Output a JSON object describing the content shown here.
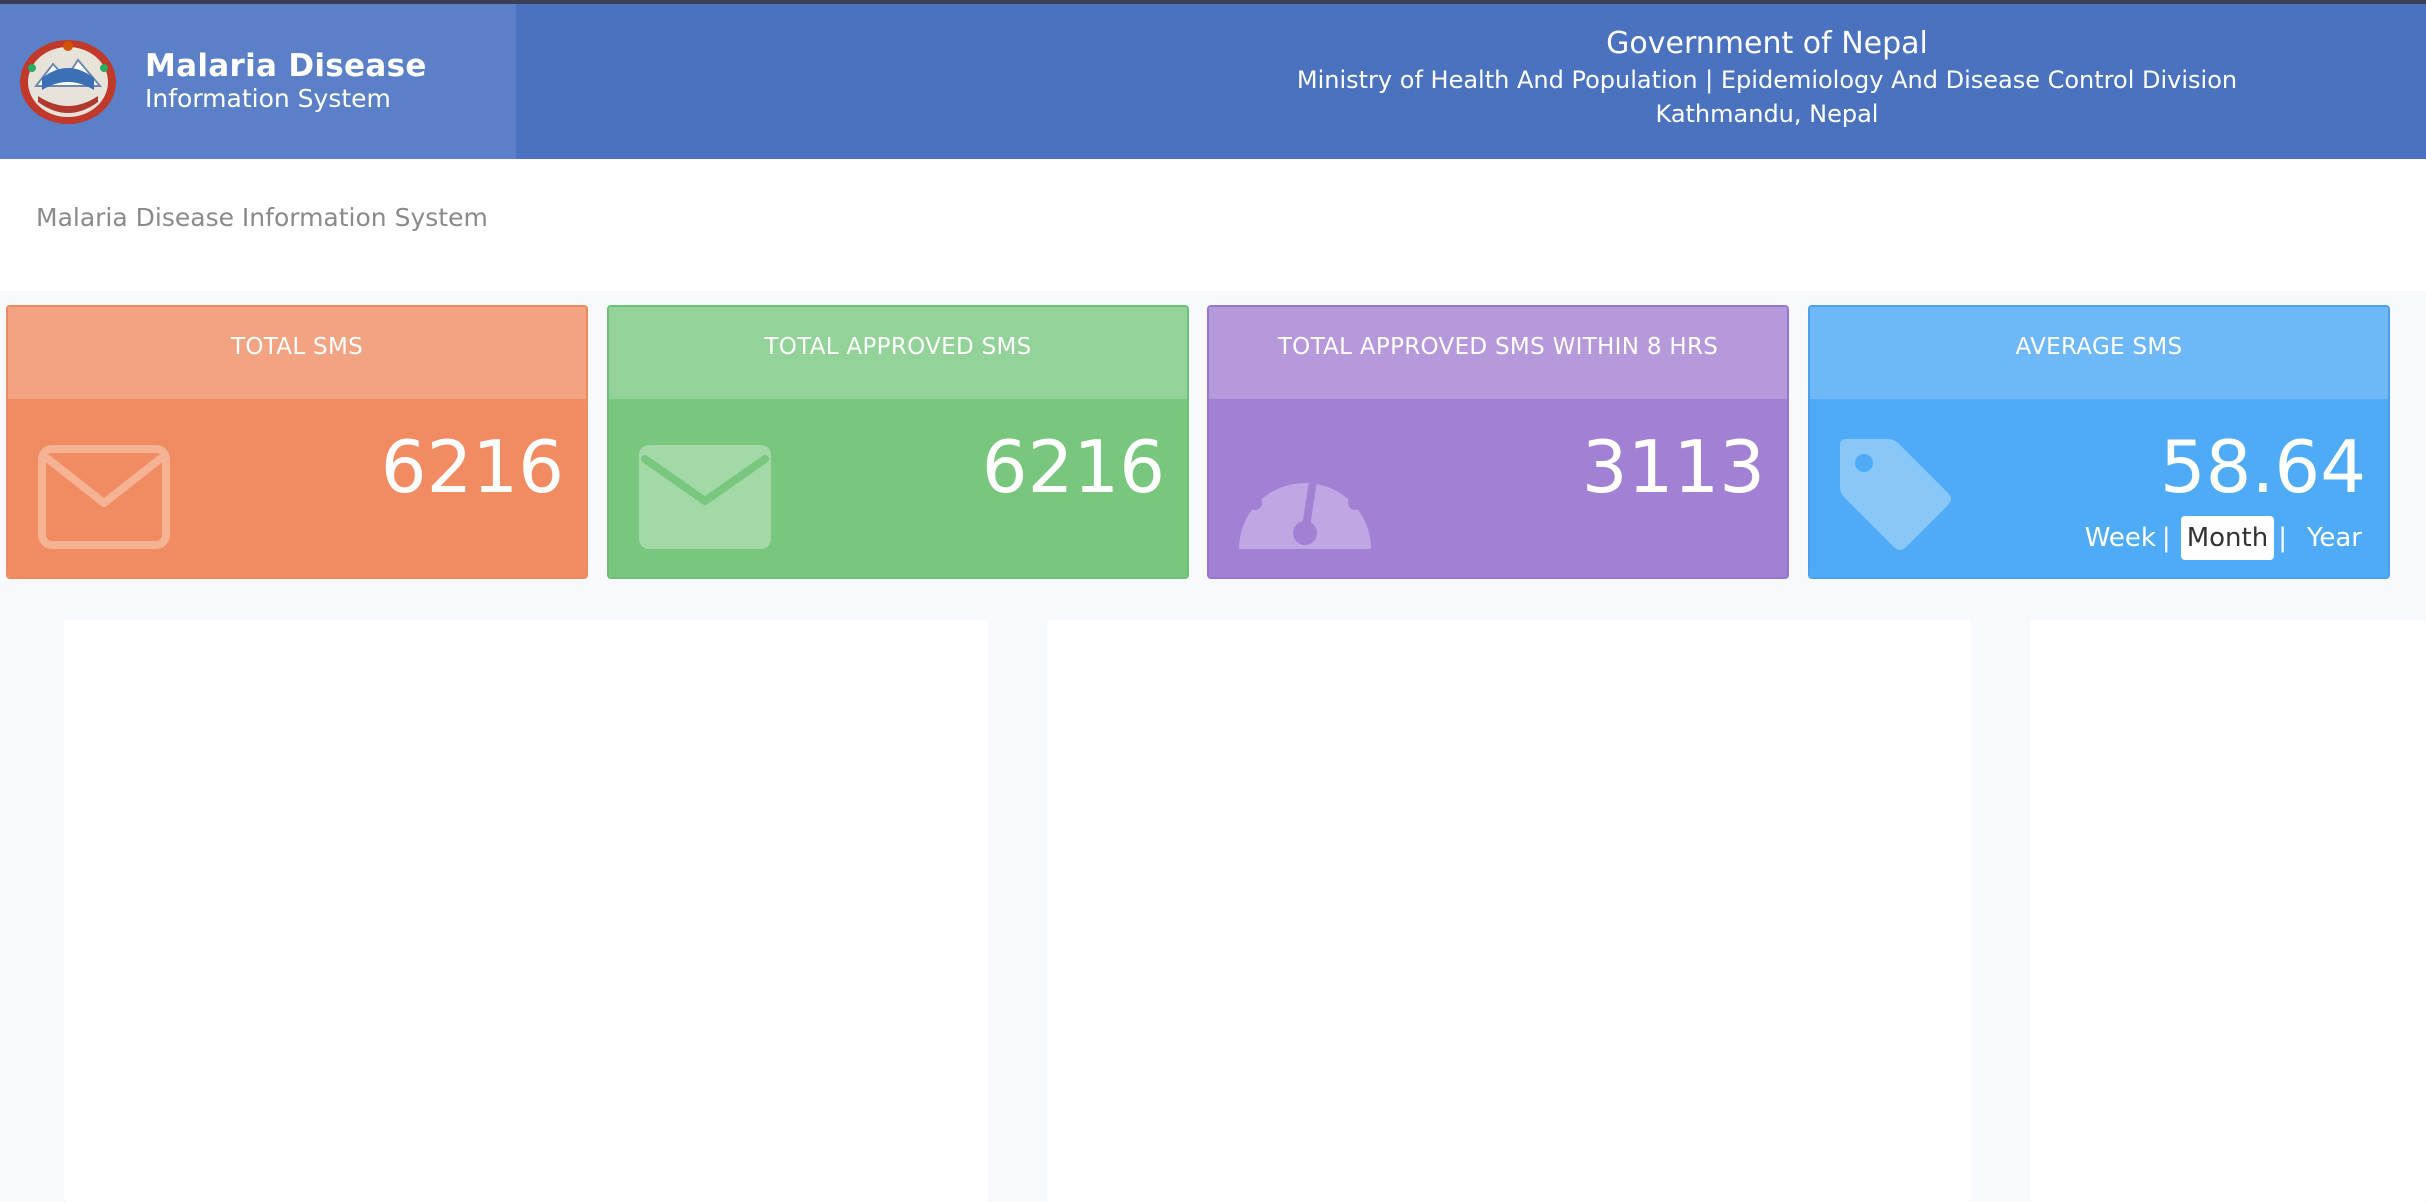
{
  "header": {
    "brand_line1": "Malaria Disease",
    "brand_line2": "Information System",
    "gov_title": "Government of Nepal",
    "gov_ministry": "Ministry of Health And Population | Epidemiology And Disease Control Division",
    "gov_city": "Kathmandu, Nepal"
  },
  "breadcrumb": "Malaria Disease Information System",
  "cards": [
    {
      "title": "TOTAL SMS",
      "value": "6216",
      "icon": "envelope-outline-icon",
      "color": "#f08b62"
    },
    {
      "title": "TOTAL APPROVED SMS",
      "value": "6216",
      "icon": "envelope-icon",
      "color": "#79c67e"
    },
    {
      "title": "TOTAL APPROVED SMS WITHIN 8 HRS",
      "value": "3113",
      "icon": "dashboard-gauge-icon",
      "color": "#a281d4"
    },
    {
      "title": "AVERAGE SMS",
      "value": "58.64",
      "icon": "tag-icon",
      "color": "#4fabf6"
    }
  ],
  "average_period": {
    "week": "Week",
    "sep1": "|",
    "month": "Month",
    "sep2": "|",
    "year": "Year",
    "selected": "Month"
  },
  "colors": {
    "header": "#4a72be",
    "brand": "#5b80c7"
  }
}
